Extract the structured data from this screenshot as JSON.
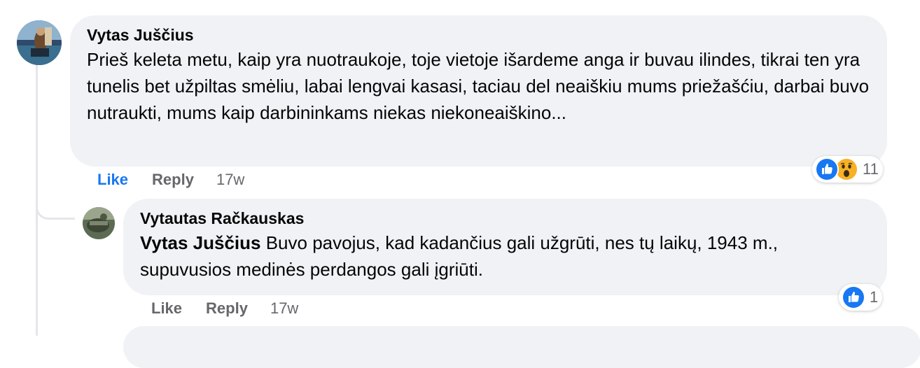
{
  "comments": [
    {
      "author": "Vytas Juščius",
      "text": "Prieš keleta metu, kaip yra nuotraukoje, toje vietoje išardeme anga ir buvau ilindes, tikrai ten yra tunelis bet užpiltas smėliu, labai lengvai kasasi, taciau del neaiškiu mums priežašćiu, darbai buvo nutraukti, mums kaip darbininkams niekas niekoneaiškino...",
      "like_label": "Like",
      "reply_label": "Reply",
      "time": "17w",
      "reactions": {
        "icons": [
          "like-icon",
          "wow-icon"
        ],
        "count": "11"
      }
    },
    {
      "author": "Vytautas Račkauskas",
      "mention": "Vytas Juščius",
      "text": "Buvo pavojus, kad kadančius gali užgrūti, nes tų laikų, 1943 m., supuvusios medinės perdangos gali įgriūti.",
      "like_label": "Like",
      "reply_label": "Reply",
      "time": "17w",
      "reactions": {
        "icons": [
          "like-icon"
        ],
        "count": "1"
      }
    }
  ],
  "colors": {
    "bubble_bg": "#f0f2f5",
    "like_active": "#1877f2",
    "muted": "#65676b",
    "text": "#050505",
    "like_icon": "#1877f2",
    "wow_icon": "#f7b125"
  }
}
